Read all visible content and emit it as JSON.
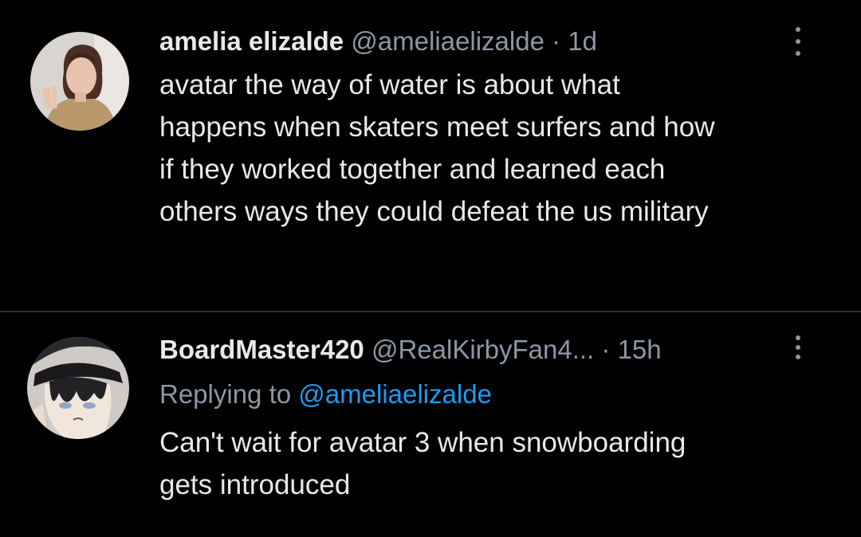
{
  "tweets": [
    {
      "display_name": "amelia elizalde",
      "handle": "@ameliaelizalde",
      "separator": "·",
      "time": "1d",
      "text_lines": [
        "avatar the way of water is about what",
        "happens when skaters meet surfers and how",
        "if they worked together and learned each",
        "others ways they could defeat the us military"
      ],
      "avatar_icon": "profile-photo"
    },
    {
      "display_name": "BoardMaster420",
      "handle": "@RealKirbyFan4...",
      "separator": "·",
      "time": "15h",
      "replying_prefix": "Replying to",
      "replying_to": "@ameliaelizalde",
      "text_lines": [
        "Can't wait for avatar 3 when snowboarding",
        "gets introduced"
      ],
      "avatar_icon": "anime-character-avatar"
    }
  ],
  "colors": {
    "background": "#000000",
    "text": "#e7e9ea",
    "secondary": "#8b98a5",
    "link": "#1d9bf0",
    "divider": "#2f3336"
  }
}
